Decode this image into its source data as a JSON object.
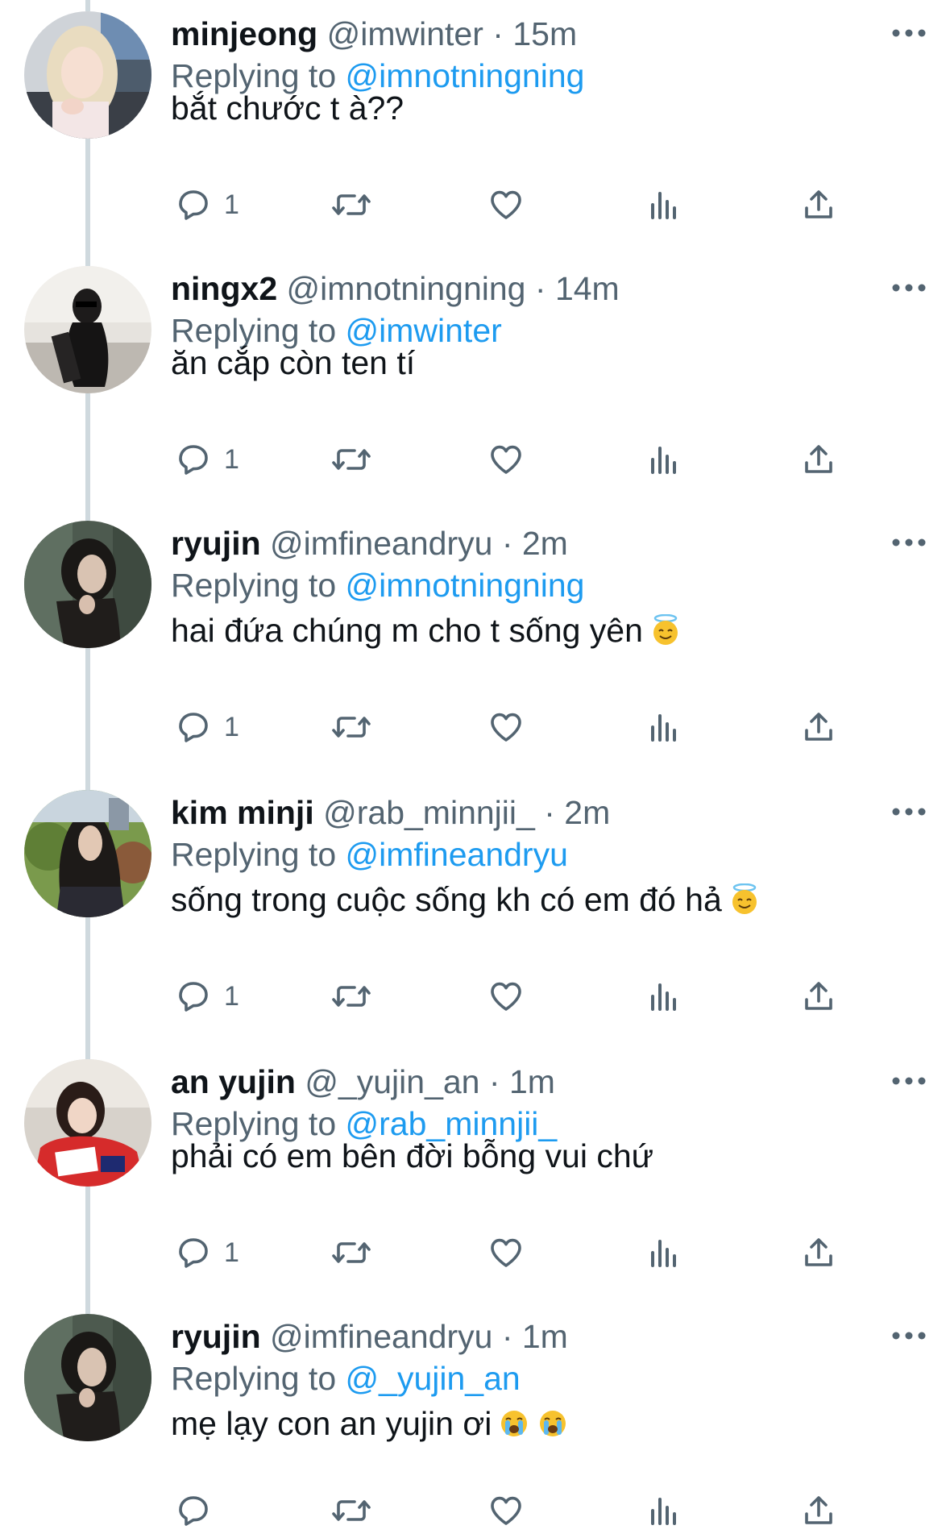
{
  "tweets": [
    {
      "name": "minjeong",
      "handle": "@imwinter",
      "time": "15m",
      "replying_prefix": "Replying to",
      "replying_to": "@imnotningning",
      "text": "bắt chước t à??",
      "emojis": [],
      "reply_count": "1"
    },
    {
      "name": "ningx2",
      "handle": "@imnotningning",
      "time": "14m",
      "replying_prefix": "Replying to",
      "replying_to": "@imwinter",
      "text": "ăn cắp còn ten tí",
      "emojis": [],
      "reply_count": "1"
    },
    {
      "name": "ryujin",
      "handle": "@imfineandryu",
      "time": "2m",
      "replying_prefix": "Replying to",
      "replying_to": "@imnotningning",
      "text": "hai đứa chúng m cho t sống yên",
      "emojis": [
        "smiling-face-with-halo"
      ],
      "reply_count": "1"
    },
    {
      "name": "kim minji",
      "handle": "@rab_minnjii_",
      "time": "2m",
      "replying_prefix": "Replying to",
      "replying_to": "@imfineandryu",
      "text": "sống trong cuộc sống kh có em đó hả",
      "emojis": [
        "smiling-face-with-halo"
      ],
      "reply_count": "1"
    },
    {
      "name": "an yujin",
      "handle": "@_yujin_an",
      "time": "1m",
      "replying_prefix": "Replying to",
      "replying_to": "@rab_minnjii_",
      "text": "phải có em bên đời bỗng vui chứ",
      "emojis": [],
      "reply_count": "1"
    },
    {
      "name": "ryujin",
      "handle": "@imfineandryu",
      "time": "1m",
      "replying_prefix": "Replying to",
      "replying_to": "@_yujin_an",
      "text": "mẹ lạy con an yujin ơi",
      "emojis": [
        "loudly-crying-face",
        "loudly-crying-face"
      ],
      "reply_count": ""
    }
  ],
  "icons": {
    "reply": "reply-icon",
    "retweet": "retweet-icon",
    "like": "heart-icon",
    "views": "views-icon",
    "share": "share-icon",
    "more": "more-icon"
  },
  "colors": {
    "mention": "#1d9bf0",
    "secondary_text": "#536471",
    "primary_text": "#0f1419",
    "thread_line": "#cfd9de"
  }
}
